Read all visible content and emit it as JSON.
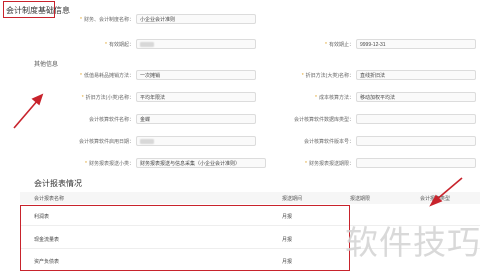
{
  "sections": {
    "basic_title": "会计制度基础信息",
    "other_title": "其他信息",
    "report_title": "会计报表情况"
  },
  "basic_fields": {
    "system_name": {
      "label": "财务、会计制度名称：",
      "value": "小企业会计准则"
    },
    "valid_from": {
      "label": "有效期起：",
      "value": ""
    },
    "valid_to": {
      "label": "有效期止：",
      "value": "9999-12-31"
    }
  },
  "other_fields": {
    "low_value": {
      "label": "低值易耗品摊销方法：",
      "value": "一次摊销"
    },
    "depreciation_major": {
      "label": "折旧方法(大类)名称：",
      "value": "直线折旧法"
    },
    "depreciation_minor": {
      "label": "折旧方法(小类)名称：",
      "value": "平均年限法"
    },
    "cost_method": {
      "label": "成本核算方法：",
      "value": "移动加权平均法"
    },
    "software_name": {
      "label": "会计核算软件名称：",
      "value": "金蝶"
    },
    "software_db": {
      "label": "会计核算软件数据库类型：",
      "value": ""
    },
    "software_date": {
      "label": "会计核算软件启用日期：",
      "value": ""
    },
    "software_version": {
      "label": "会计核算软件版本号：",
      "value": ""
    },
    "report_type": {
      "label": "财务报表报送小类：",
      "value": "财务报表报送与信息采集（小企业会计准则）"
    },
    "report_cycle": {
      "label": "财务报表报送期限：",
      "value": ""
    }
  },
  "report_table": {
    "headers": [
      "会计报表名称",
      "报送期间",
      "报送期限",
      "会计报表类型"
    ],
    "rows": [
      {
        "name": "利润表",
        "period": "月报"
      },
      {
        "name": "现金流量表",
        "period": "月报"
      },
      {
        "name": "资产负债表",
        "period": "月报"
      }
    ]
  },
  "watermark": "软件技巧",
  "colors": {
    "annotation_red": "#c8232c",
    "required_star": "#e0a020"
  }
}
